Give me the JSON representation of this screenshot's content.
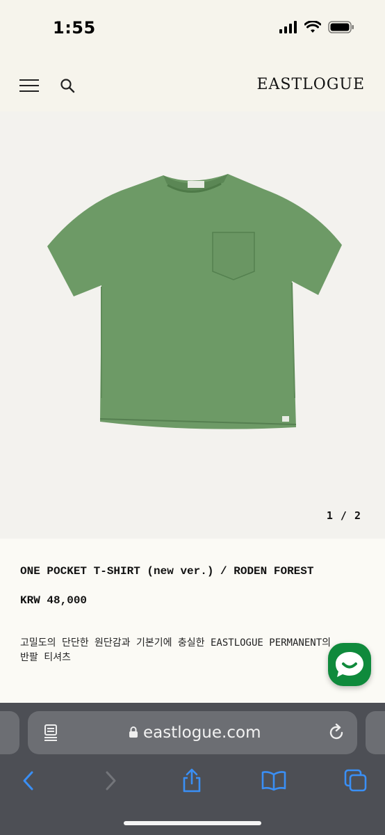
{
  "status_bar": {
    "time": "1:55"
  },
  "header": {
    "brand": "EASTLOGUE"
  },
  "gallery": {
    "counter": "1 / 2",
    "image_subject": "green short-sleeve pocket t-shirt"
  },
  "product": {
    "title": "ONE POCKET T-SHIRT (new ver.) / RODEN FOREST",
    "price": "KRW 48,000",
    "description_line1": "고밀도의 단단한 원단감과 기본기에 충실한 EASTLOGUE PERMANENT의",
    "description_line2": "반팔 티셔츠"
  },
  "browser": {
    "url": "eastlogue.com"
  },
  "colors": {
    "chat": "#0f8a3c",
    "shirt": "#6d9a66",
    "toolbar_icon": "#3a8ff5"
  },
  "icons": [
    "menu-icon",
    "search-icon",
    "chat-icon",
    "reader-icon",
    "lock-icon",
    "reload-icon",
    "back-icon",
    "forward-icon",
    "share-icon",
    "bookmarks-icon",
    "tabs-icon"
  ]
}
